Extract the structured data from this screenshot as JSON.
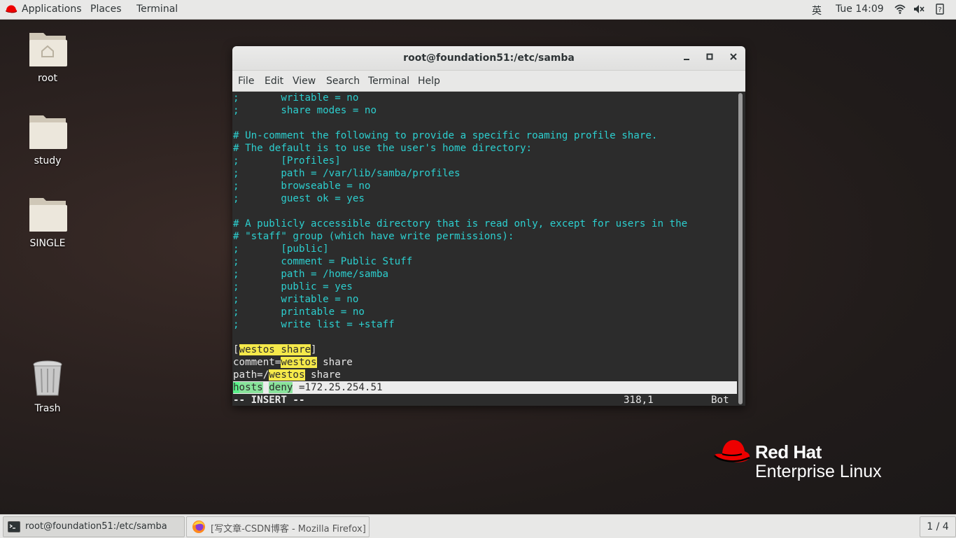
{
  "topbar": {
    "applications": "Applications",
    "places": "Places",
    "terminal": "Terminal",
    "input_method": "英",
    "clock": "Tue 14:09"
  },
  "desktop": {
    "icons": [
      "root",
      "study",
      "SINGLE",
      "Trash"
    ]
  },
  "window": {
    "title": "root@foundation51:/etc/samba",
    "minimize": "–",
    "maximize": "□",
    "close": "✕",
    "menu": [
      "File",
      "Edit",
      "View",
      "Search",
      "Terminal",
      "Help"
    ]
  },
  "editor": {
    "lines": [
      ";       writable = no",
      ";       share modes = no",
      "",
      "# Un-comment the following to provide a specific roaming profile share.",
      "# The default is to use the user's home directory:",
      ";       [Profiles]",
      ";       path = /var/lib/samba/profiles",
      ";       browseable = no",
      ";       guest ok = yes",
      "",
      "# A publicly accessible directory that is read only, except for users in the",
      "# \"staff\" group (which have write permissions):",
      ";       [public]",
      ";       comment = Public Stuff",
      ";       path = /home/samba",
      ";       public = yes",
      ";       writable = no",
      ";       printable = no",
      ";       write list = +staff",
      ""
    ],
    "custom": {
      "l1_open": "[",
      "l1_hl": "westos share",
      "l1_close": "]",
      "l2_key": "comment=",
      "l2_hl": "westos",
      "l2_rest": " share",
      "l3_key": "path=/",
      "l3_hl": "westos",
      "l3_rest": " share",
      "l4_cursor": "h",
      "l4_hl1": "osts",
      "l4_sp": " ",
      "l4_hl2": "deny",
      "l4_rest": " =172.25.254.51"
    },
    "status_mode": "-- INSERT --",
    "status_pos": "318,1",
    "status_scroll": "Bot"
  },
  "brand": {
    "line1": "Red Hat",
    "line2": "Enterprise Linux"
  },
  "taskbar": {
    "tasks": [
      "root@foundation51:/etc/samba",
      "[写文章-CSDN博客 - Mozilla Firefox]"
    ],
    "pager": "1 / 4"
  },
  "colors": {
    "comment": "#2ccfcf",
    "highlight": "#f5e94a",
    "highlight_green": "#88e29a",
    "redhat": "#ee0000"
  }
}
